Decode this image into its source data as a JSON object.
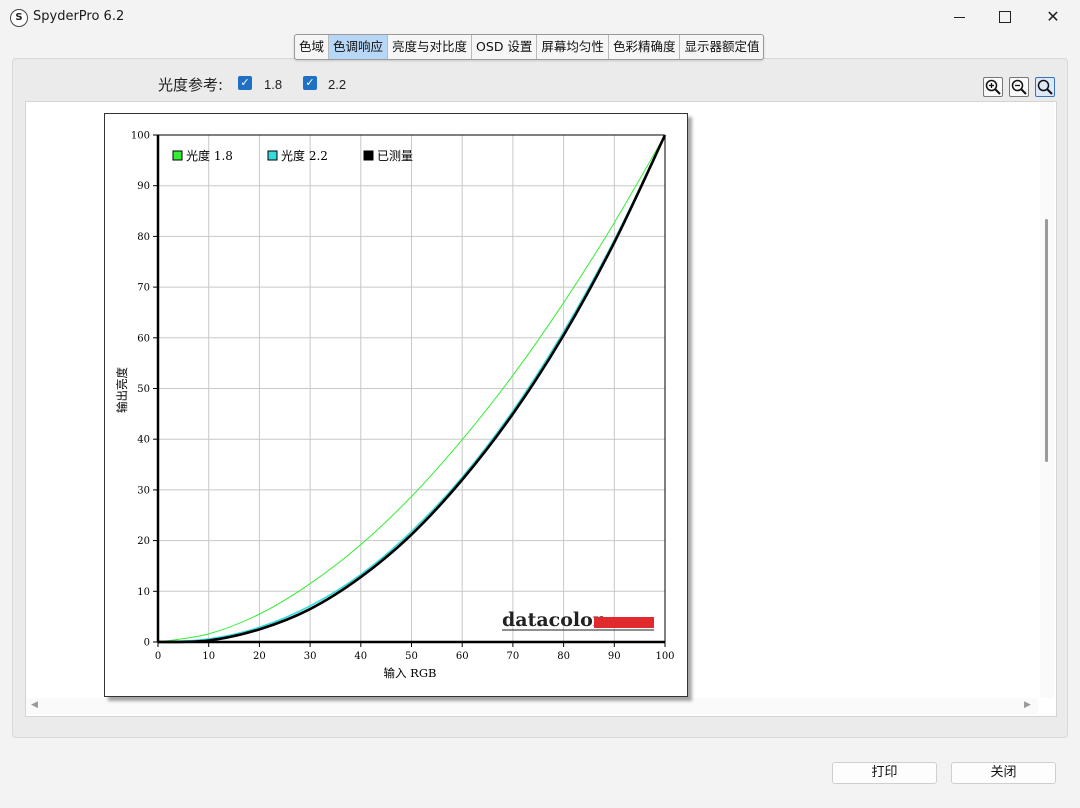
{
  "window": {
    "title": "SpyderPro 6.2",
    "icon_letter": "S"
  },
  "tabs": [
    {
      "label": "色域",
      "active": false
    },
    {
      "label": "色调响应",
      "active": true
    },
    {
      "label": "亮度与对比度",
      "active": false
    },
    {
      "label": "OSD 设置",
      "active": false
    },
    {
      "label": "屏幕均匀性",
      "active": false
    },
    {
      "label": "色彩精确度",
      "active": false
    },
    {
      "label": "显示器额定值",
      "active": false
    }
  ],
  "reference": {
    "label": "光度参考:",
    "options": [
      {
        "value": "1.8",
        "checked": true
      },
      {
        "value": "2.2",
        "checked": true
      }
    ]
  },
  "buttons": {
    "print": "打印",
    "close": "关闭"
  },
  "chart_data": {
    "type": "line",
    "title": "",
    "xlabel": "输入 RGB",
    "ylabel": "输出亮度",
    "xlim": [
      0,
      100
    ],
    "ylim": [
      0,
      100
    ],
    "grid": true,
    "legend_placement": "top-left",
    "x_ticks": [
      "0",
      "10",
      "20",
      "30",
      "40",
      "50",
      "60",
      "70",
      "80",
      "90",
      "100"
    ],
    "y_ticks": [
      "0",
      "10",
      "20",
      "30",
      "40",
      "50",
      "60",
      "70",
      "80",
      "90",
      "100"
    ],
    "logo": "datacolor",
    "series": [
      {
        "name": "光度 1.8",
        "color": "#33ee33",
        "x": [
          0,
          10,
          20,
          30,
          40,
          50,
          60,
          70,
          80,
          90,
          100
        ],
        "y": [
          0,
          1.6,
          5.5,
          11.5,
          19.2,
          28.7,
          39.9,
          52.6,
          66.9,
          82.7,
          100
        ]
      },
      {
        "name": "光度 2.2",
        "color": "#33dddd",
        "x": [
          0,
          10,
          20,
          30,
          40,
          50,
          60,
          70,
          80,
          90,
          100
        ],
        "y": [
          0,
          0.6,
          2.9,
          7.1,
          13.3,
          21.8,
          32.5,
          45.6,
          61.2,
          79.3,
          100
        ]
      },
      {
        "name": "已测量",
        "color": "#000000",
        "x": [
          0,
          10,
          20,
          30,
          40,
          50,
          60,
          70,
          80,
          90,
          100
        ],
        "y": [
          0,
          0.3,
          2.5,
          6.5,
          12.8,
          21.2,
          32.0,
          45.0,
          60.5,
          78.8,
          100
        ]
      }
    ]
  }
}
